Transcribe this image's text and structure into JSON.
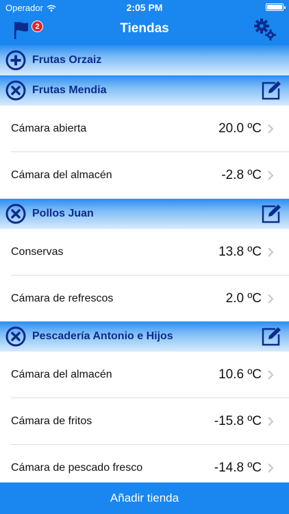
{
  "status_bar": {
    "carrier": "Operador",
    "time": "2:05 PM"
  },
  "nav": {
    "title": "Tiendas",
    "alerts_badge": "2"
  },
  "stores": [
    {
      "name": "Frutas Orzaiz",
      "state": "collapsed",
      "rows": []
    },
    {
      "name": "Frutas Mendia",
      "state": "expanded",
      "rows": [
        {
          "name": "Cámara abierta",
          "temp": "20.0 ºC"
        },
        {
          "name": "Cámara del almacén",
          "temp": "-2.8 ºC"
        }
      ]
    },
    {
      "name": "Pollos Juan",
      "state": "expanded",
      "rows": [
        {
          "name": "Conservas",
          "temp": "13.8 ºC"
        },
        {
          "name": "Cámara de refrescos",
          "temp": "2.0 ºC"
        }
      ]
    },
    {
      "name": "Pescadería Antonio e Hijos",
      "state": "expanded",
      "rows": [
        {
          "name": "Cámara del almacén",
          "temp": "10.6 ºC"
        },
        {
          "name": "Cámara de fritos",
          "temp": "-15.8 ºC"
        },
        {
          "name": "Cámara de pescado fresco",
          "temp": "-14.8 ºC"
        }
      ]
    }
  ],
  "footer": {
    "add_label": "Añadir tienda"
  },
  "icons": {
    "expand": "plus-circle-icon",
    "collapse": "x-circle-icon",
    "edit": "edit-icon",
    "settings": "gears-icon",
    "alerts": "flag-icon",
    "disclosure": "chevron-right-icon"
  },
  "colors": {
    "accent": "#1a86f0",
    "section_text": "#0c2b8c",
    "badge": "#e8232a"
  }
}
